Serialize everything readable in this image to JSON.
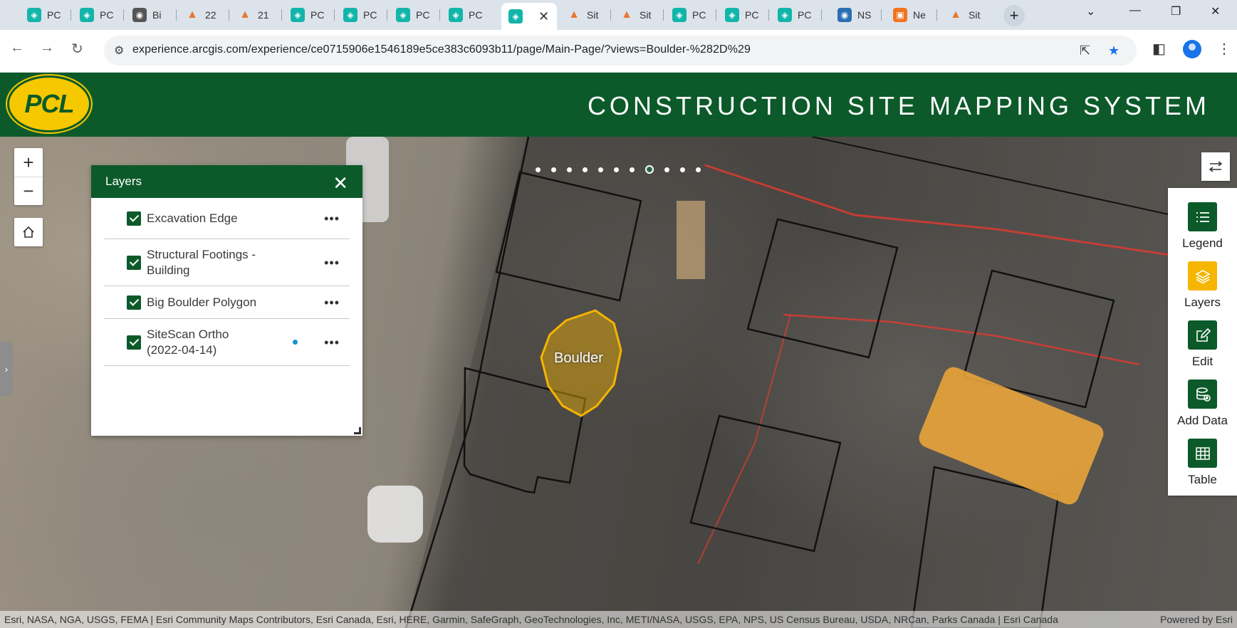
{
  "browser": {
    "tabs": [
      {
        "label": "PC",
        "icon": "teal-app-icon"
      },
      {
        "label": "PC",
        "icon": "teal-app-icon"
      },
      {
        "label": "Bi",
        "icon": "globe-icon"
      },
      {
        "label": "22",
        "icon": "arcgis-orange-icon"
      },
      {
        "label": "21",
        "icon": "arcgis-orange-icon"
      },
      {
        "label": "PC",
        "icon": "teal-app-icon"
      },
      {
        "label": "PC",
        "icon": "teal-app-icon"
      },
      {
        "label": "PC",
        "icon": "teal-app-icon"
      },
      {
        "label": "PC",
        "icon": "teal-app-icon"
      },
      {
        "label": "",
        "icon": "teal-app-icon",
        "active": true
      },
      {
        "label": "Sit",
        "icon": "arcgis-orange-icon"
      },
      {
        "label": "Sit",
        "icon": "arcgis-orange-icon"
      },
      {
        "label": "PC",
        "icon": "teal-app-icon"
      },
      {
        "label": "PC",
        "icon": "teal-app-icon"
      },
      {
        "label": "PC",
        "icon": "teal-app-icon"
      },
      {
        "label": "NS",
        "icon": "ns-globe-icon"
      },
      {
        "label": "Ne",
        "icon": "orange-box-icon"
      },
      {
        "label": "Sit",
        "icon": "arcgis-orange-icon"
      }
    ],
    "url": "experience.arcgis.com/experience/ce0715906e1546189e5ce383c6093b11/page/Main-Page/?views=Boulder-%282D%29"
  },
  "app": {
    "logo_text": "PCL",
    "title": "CONSTRUCTION SITE MAPPING SYSTEM",
    "brand_color": "#0c5a2a",
    "accent_color": "#f5b500"
  },
  "map": {
    "boulder_label": "Boulder",
    "view_dots_count": 11,
    "view_dots_current": 7,
    "attribution": "Esri, NASA, NGA, USGS, FEMA | Esri Community Maps Contributors, Esri Canada, Esri, HERE, Garmin, SafeGraph, GeoTechnologies, Inc, METI/NASA, USGS, EPA, NPS, US Census Bureau, USDA, NRCan, Parks Canada | Esri Canada",
    "powered_by": "Powered by Esri"
  },
  "layers_panel": {
    "title": "Layers",
    "items": [
      {
        "label": "Excavation Edge",
        "checked": true
      },
      {
        "label": "Structural Footings - Building",
        "checked": true
      },
      {
        "label": "Big Boulder Polygon",
        "checked": true
      },
      {
        "label": "SiteScan Ortho (2022-04-14)",
        "checked": true,
        "updating": true
      }
    ]
  },
  "toolbar": {
    "items": [
      {
        "label": "Legend",
        "icon": "list-icon",
        "selected": false
      },
      {
        "label": "Layers",
        "icon": "layers-icon",
        "selected": true
      },
      {
        "label": "Edit",
        "icon": "edit-icon",
        "selected": false
      },
      {
        "label": "Add Data",
        "icon": "add-data-icon",
        "selected": false
      },
      {
        "label": "Table",
        "icon": "table-icon",
        "selected": false
      }
    ]
  }
}
